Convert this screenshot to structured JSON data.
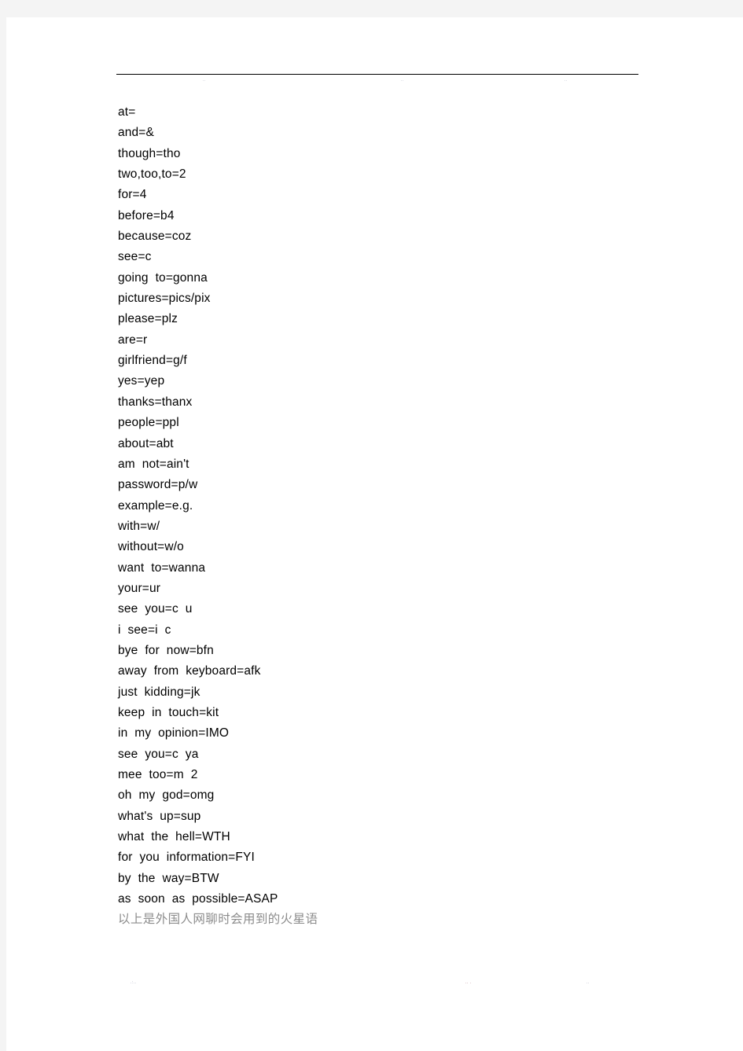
{
  "page": {
    "background_color": "#f4f4f4",
    "sheet_color": "#ffffff",
    "rule_color": "#000000"
  },
  "header": {
    "marks": [
      "..",
      "..",
      ".."
    ]
  },
  "footer": {
    "marks": [
      ".:..",
      ".. .",
      ".."
    ]
  },
  "body": {
    "text_color": "#000000",
    "note_color": "#8c8c8c",
    "entries": [
      "at=",
      "and=&",
      "though=tho",
      "two,too,to=2",
      "for=4",
      "before=b4",
      "because=coz",
      "see=c",
      "going  to=gonna",
      "pictures=pics/pix",
      "please=plz",
      "are=r",
      "girlfriend=g/f",
      "yes=yep",
      "thanks=thanx",
      "people=ppl",
      "about=abt",
      "am  not=ain't",
      "password=p/w",
      "example=e.g.",
      "with=w/",
      "without=w/o",
      "want  to=wanna",
      "your=ur",
      "see  you=c  u",
      "i  see=i  c",
      "bye  for  now=bfn",
      "away  from  keyboard=afk",
      "just  kidding=jk",
      "keep  in  touch=kit",
      "in  my  opinion=IMO",
      "see  you=c  ya",
      "mee  too=m  2",
      "oh  my  god=omg",
      "what's  up=sup",
      "what  the  hell=WTH",
      "for  you  information=FYI",
      "by  the  way=BTW",
      "as  soon  as  possible=ASAP"
    ],
    "note": "以上是外国人网聊时会用到的火星语"
  }
}
